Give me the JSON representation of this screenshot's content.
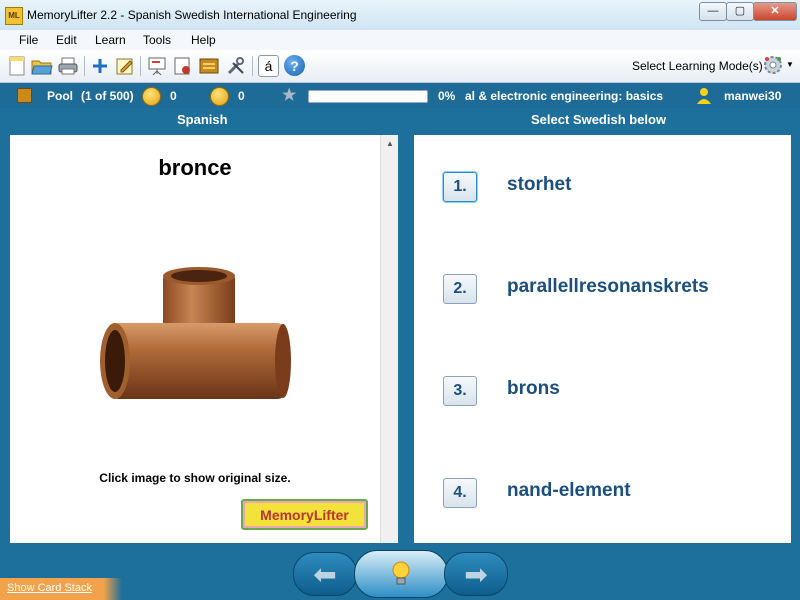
{
  "window": {
    "title": "MemoryLifter 2.2 - Spanish Swedish International Engineering",
    "app_icon_text": "ML"
  },
  "menu": {
    "items": [
      "File",
      "Edit",
      "Learn",
      "Tools",
      "Help"
    ]
  },
  "toolbar": {
    "icons": [
      "new-icon",
      "open-icon",
      "print-icon",
      "add-icon",
      "edit-icon",
      "presentation-icon",
      "slideshow-icon",
      "card-icon",
      "tools-icon",
      "special-char-icon",
      "help-icon"
    ],
    "special_char": "á",
    "help_char": "?",
    "mode_label": "Select Learning Mode(s)"
  },
  "status": {
    "pool_label": "Pool",
    "pool_count": "(1 of 500)",
    "happy_count": "0",
    "sad_count": "0",
    "progress_text": "0%",
    "progress_value": 0,
    "lesson_title": "al & electronic engineering: basics",
    "user": "manwei30"
  },
  "left": {
    "header": "Spanish",
    "word": "bronce",
    "hint": "Click image to show original size.",
    "logo_text": "MemoryLifter"
  },
  "right": {
    "header": "Select Swedish below",
    "answers": [
      {
        "num": "1.",
        "text": "storhet"
      },
      {
        "num": "2.",
        "text": "parallellresonanskrets"
      },
      {
        "num": "3.",
        "text": "brons"
      },
      {
        "num": "4.",
        "text": "nand-element"
      }
    ]
  },
  "footer": {
    "show_stack": "Show Card Stack"
  },
  "colors": {
    "background": "#1d6f9c",
    "accent_text": "#1b4f80",
    "highlight": "#f2a24a"
  }
}
